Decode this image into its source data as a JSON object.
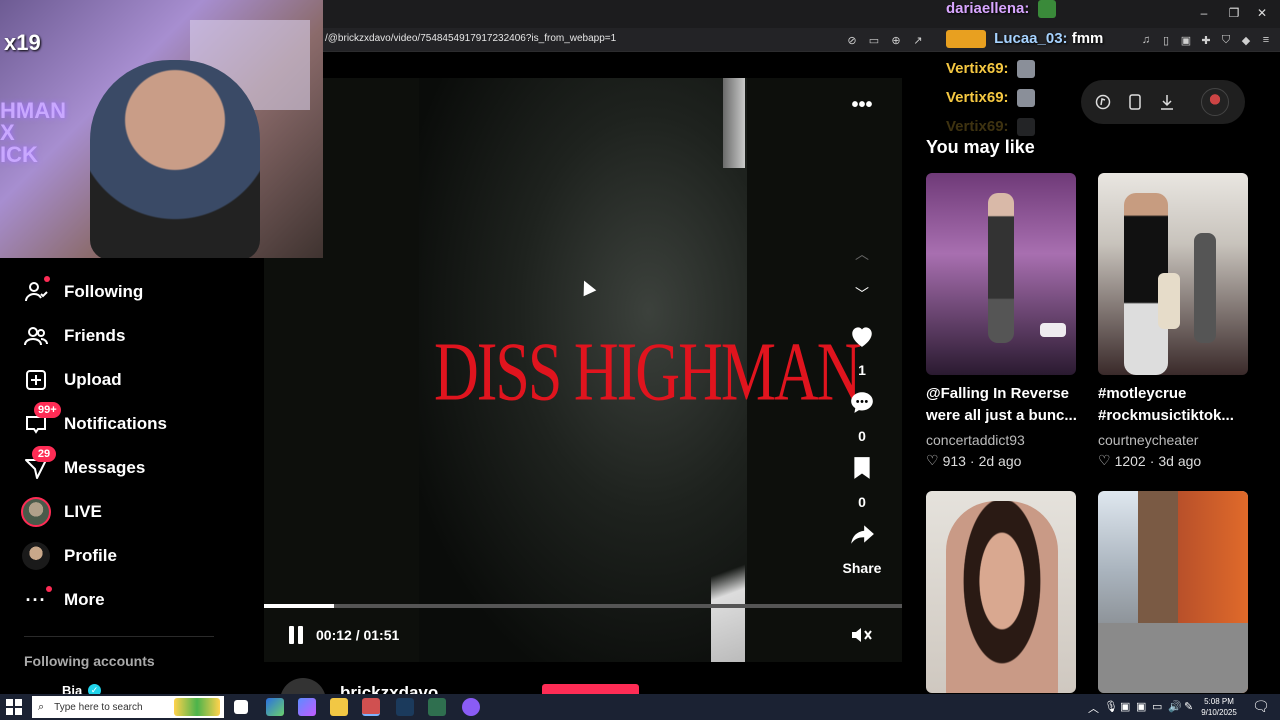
{
  "browser": {
    "url": "/@brickzxdavo/video/7548454917917232406?is_from_webapp=1",
    "window_controls": {
      "minimize": "–",
      "restore": "❐",
      "close": "✕"
    }
  },
  "webcam": {
    "overlay_label": "x19",
    "neon_sign": "HMAN\nX\nICK"
  },
  "chat": [
    {
      "user": "dariaellena:",
      "message": "",
      "color": "purple"
    },
    {
      "user": "Lucaa_03:",
      "message": "fmm",
      "color": "blue"
    },
    {
      "user": "Vertix69:",
      "message": "",
      "color": "gold"
    },
    {
      "user": "Vertix69:",
      "message": "",
      "color": "gold"
    },
    {
      "user": "Vertix69:",
      "message": "",
      "color": "gold"
    }
  ],
  "sidebar": {
    "items": [
      {
        "label": "Following",
        "icon": "following-icon",
        "glyph": "👤"
      },
      {
        "label": "Friends",
        "icon": "friends-icon",
        "glyph": "👥"
      },
      {
        "label": "Upload",
        "icon": "upload-icon",
        "glyph": "⊞"
      },
      {
        "label": "Notifications",
        "icon": "notifications-icon",
        "glyph": "▭",
        "badge": "99+"
      },
      {
        "label": "Messages",
        "icon": "messages-icon",
        "glyph": "➢",
        "badge": "29"
      },
      {
        "label": "LIVE",
        "icon": "live-icon",
        "glyph": ""
      },
      {
        "label": "Profile",
        "icon": "profile-icon",
        "glyph": ""
      },
      {
        "label": "More",
        "icon": "more-icon",
        "glyph": "···"
      }
    ],
    "following_accounts_heading": "Following accounts",
    "accounts": [
      {
        "name": "Bia"
      }
    ]
  },
  "video": {
    "title_text": "DISS HIGHMAN",
    "current_time": "00:12",
    "duration": "01:51",
    "time_display": "00:12 / 01:51",
    "progress": 0.11,
    "likes": "1",
    "comments": "0",
    "saves": "0",
    "share_label": "Share",
    "author": "brickzxdavo"
  },
  "recommendations": {
    "heading": "You may like",
    "items": [
      {
        "caption_line1": "@Falling In Reverse",
        "caption_line2": "were all just a bunc...",
        "author": "concertaddict93",
        "likes": "913",
        "age": "2d ago"
      },
      {
        "caption_line1": "#motleycrue",
        "caption_line2": "#rockmusictiktok...",
        "author": "courtneycheater",
        "likes": "1202",
        "age": "3d ago"
      },
      {
        "caption_line1": "",
        "caption_line2": "",
        "author": "",
        "likes": "",
        "age": ""
      },
      {
        "caption_line1": "",
        "caption_line2": "",
        "author": "",
        "likes": "",
        "age": ""
      }
    ]
  },
  "taskbar": {
    "search_placeholder": "Type here to search",
    "time": "5:08 PM",
    "date": "9/10/2025"
  },
  "colors": {
    "accent": "#fe2c55",
    "title_red": "#e0141e",
    "background": "#000000"
  }
}
